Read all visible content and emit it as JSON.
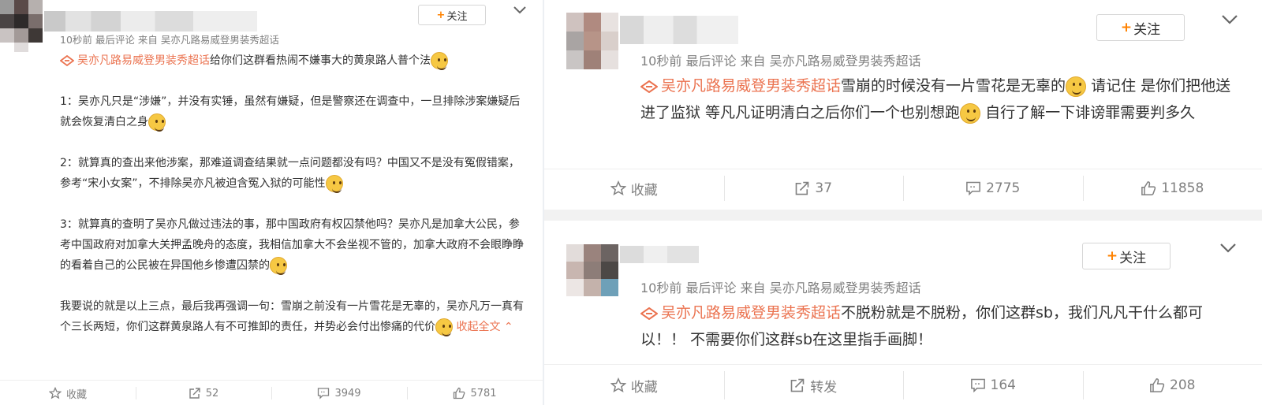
{
  "left": {
    "meta": "10秒前 最后评论 来自 吴亦凡路易威登男装秀超话",
    "follow_label": "关注",
    "topic": "吴亦凡路易威登男装秀超话",
    "intro": "给你们这群看热闹不嫌事大的黄泉路人普个法",
    "p1": "1：吴亦凡只是“涉嫌”，并没有实锤，虽然有嫌疑，但是警察还在调查中，一旦排除涉案嫌疑后就会恢复清白之身",
    "p2": "2：就算真的查出来他涉案，那难道调查结果就一点问题都没有吗？中国又不是没有冤假错案，参考“宋小女案”，不排除吴亦凡被迫含冤入狱的可能性",
    "p3": "3：就算真的查明了吴亦凡做过违法的事，那中国政府有权囚禁他吗？吴亦凡是加拿大公民，参考中国政府对加拿大关押孟晚舟的态度，我相信加拿大不会坐视不管的，加拿大政府不会眼睁睁的看着自己的公民被在异国他乡惨遭囚禁的",
    "p4": "我要说的就是以上三点，最后我再强调一句：雪崩之前没有一片雪花是无辜的，吴亦凡万一真有个三长两短，你们这群黄泉路人有不可推卸的责任，并势必会付出惨痛的代价",
    "collapse_label": "收起全文",
    "actions": {
      "favorite": "收藏",
      "repost": "52",
      "comment": "3949",
      "like": "5781"
    }
  },
  "right_top": {
    "meta": "10秒前 最后评论 来自 吴亦凡路易威登男装秀超话",
    "follow_label": "关注",
    "topic": "吴亦凡路易威登男装秀超话",
    "t1": "雪崩的时候没有一片雪花是无辜的",
    "t2": " 请记住 是你们把他送进了监狱 等凡凡证明清白之后你们一个也别想跑",
    "t3": " 自行了解一下诽谤罪需要判多久",
    "actions": {
      "favorite": "收藏",
      "repost": "37",
      "comment": "2775",
      "like": "11858"
    }
  },
  "right_bottom": {
    "meta": "10秒前 最后评论 来自 吴亦凡路易威登男装秀超话",
    "follow_label": "关注",
    "topic": "吴亦凡路易威登男装秀超话",
    "t1": "不脱粉就是不脱粉，你们这群sb，我们凡凡干什么都可以！！ 不需要你们这群sb在这里指手画脚！",
    "actions": {
      "favorite": "收藏",
      "repost": "转发",
      "comment": "164",
      "like": "208"
    }
  },
  "colors": {
    "accent": "#ff8200",
    "topic": "#eb7350",
    "meta": "#808080"
  }
}
